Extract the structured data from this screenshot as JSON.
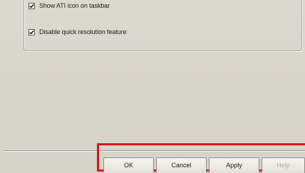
{
  "options": {
    "show_ati_icon": {
      "label": "Show ATI icon on taskbar",
      "checked": true
    },
    "disable_quick_resolution": {
      "label": "Disable quick resolution feature",
      "checked": true
    }
  },
  "buttons": {
    "ok": "OK",
    "cancel": "Cancel",
    "apply": "Apply",
    "help": "Help"
  },
  "colors": {
    "highlight_border": "#e0141b",
    "dialog_background": "#d9d6cc"
  }
}
